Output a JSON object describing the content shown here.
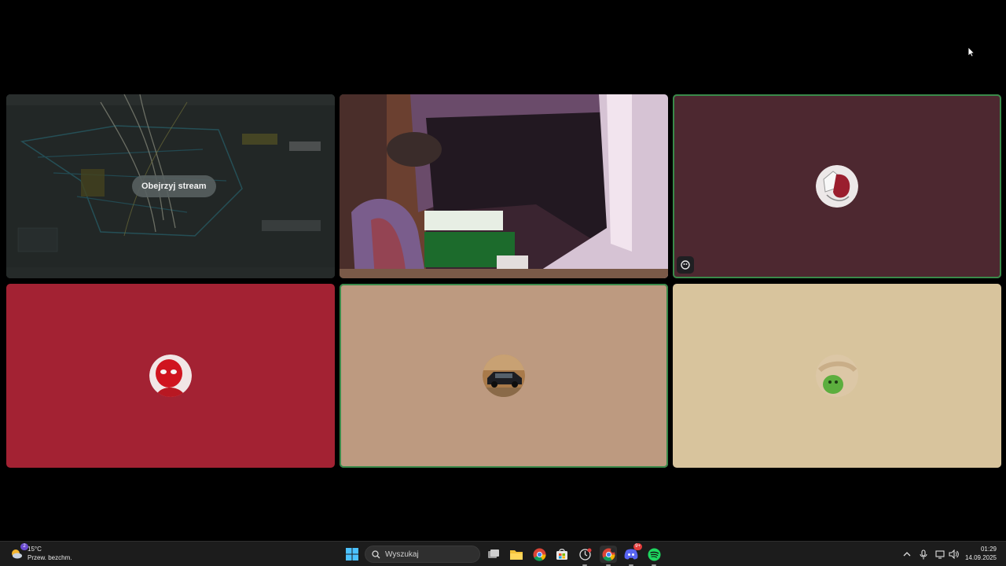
{
  "tiles": [
    {
      "id": "screen-share",
      "watch_stream_label": "Obejrzyj stream"
    },
    {
      "id": "camera"
    },
    {
      "id": "user-3",
      "color": "#4d2830",
      "speaking": true
    },
    {
      "id": "user-4",
      "color": "#a32233",
      "speaking": false
    },
    {
      "id": "user-5",
      "color": "#bd9a80",
      "speaking": true
    },
    {
      "id": "user-6",
      "color": "#d8c49d",
      "speaking": false
    }
  ],
  "taskbar": {
    "weather": {
      "temperature": "15°C",
      "condition": "Przew. bezchm.",
      "alert_count": "2"
    },
    "search_placeholder": "Wyszukaj",
    "discord_badge": "9+",
    "clock": {
      "time": "01:29",
      "date": "14.09.2025"
    }
  },
  "icons": [
    "weather-icon",
    "windows-start-icon",
    "search-icon",
    "task-view-icon",
    "file-explorer-icon",
    "chrome-icon",
    "microsoft-store-icon",
    "snipping-tool-icon",
    "chrome-profile-icon",
    "discord-icon",
    "spotify-icon",
    "chevron-up-icon",
    "microphone-icon",
    "network-icon",
    "volume-icon",
    "activity-icon",
    "mouse-cursor-icon"
  ],
  "accent_colors": {
    "speaking_ring": "#3a8a4a",
    "taskbar": "#1c1c1c"
  }
}
